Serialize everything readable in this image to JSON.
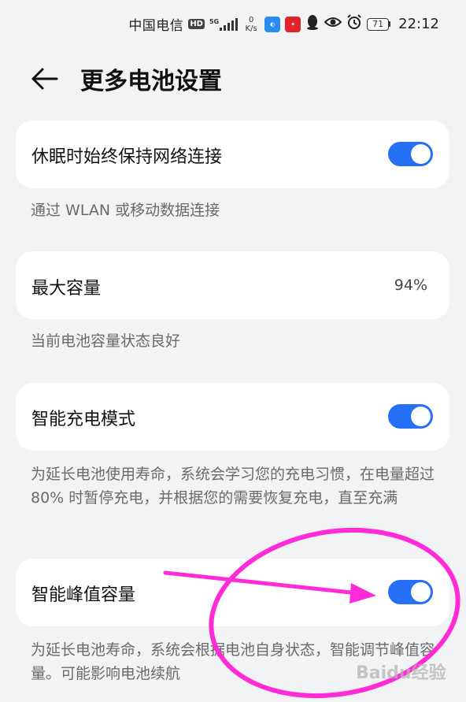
{
  "statusbar": {
    "carrier": "中国电信",
    "hd": "HD",
    "network": "5G",
    "speed_value": "0",
    "speed_unit": "K/s",
    "battery_level": "71",
    "time": "22:12",
    "icons": [
      "app-badge-blue-icon",
      "app-badge-red-icon",
      "qq-penguin-icon",
      "eye-icon",
      "alarm-icon"
    ]
  },
  "header": {
    "back_icon": "arrow-left-icon",
    "title": "更多电池设置"
  },
  "settings": [
    {
      "label": "休眠时始终保持网络连接",
      "type": "toggle",
      "enabled": true,
      "description": "通过 WLAN 或移动数据连接"
    },
    {
      "label": "最大容量",
      "type": "value",
      "value": "94%",
      "description": "当前电池容量状态良好"
    },
    {
      "label": "智能充电模式",
      "type": "toggle",
      "enabled": true,
      "description": "为延长电池使用寿命，系统会学习您的充电习惯，在电量超过 80% 时暂停充电，并根据您的需要恢复充电，直至充满"
    },
    {
      "label": "智能峰值容量",
      "type": "toggle",
      "enabled": true,
      "description": "为延长电池寿命，系统会根据电池自身状态，智能调节峰值容量。可能影响电池续航"
    }
  ],
  "colors": {
    "accent": "#2670f5",
    "background": "#f1f3f5",
    "annotation": "#ff2bd6"
  },
  "watermark": "Baidu经验"
}
